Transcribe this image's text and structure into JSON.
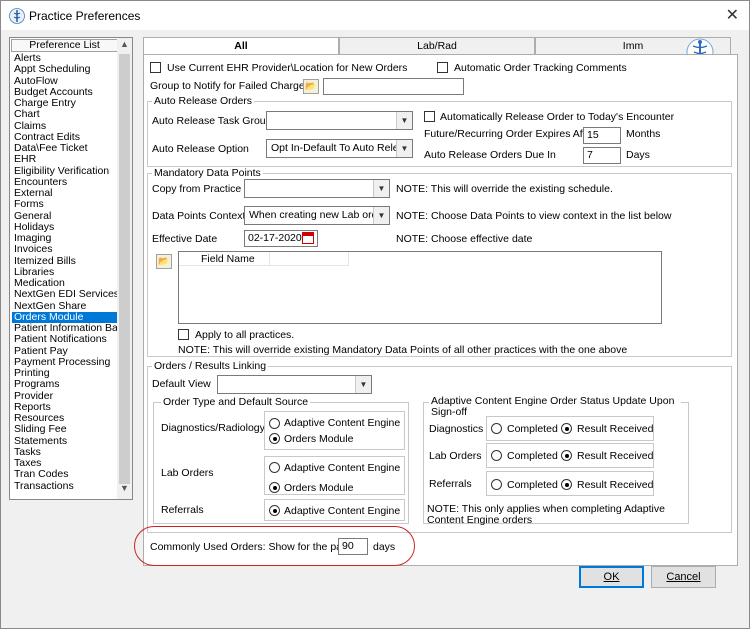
{
  "window": {
    "title": "Practice Preferences",
    "close": "✕"
  },
  "pref_list": {
    "header": "Preference List",
    "items": [
      "Alerts",
      "Appt Scheduling",
      "AutoFlow",
      "Budget Accounts",
      "Charge Entry",
      "Chart",
      "Claims",
      "Contract Edits",
      "Data\\Fee Ticket",
      "EHR",
      "Eligibility Verification",
      "Encounters",
      "External",
      "Forms",
      "General",
      "Holidays",
      "Imaging",
      "Invoices",
      "Itemized Bills",
      "Libraries",
      "Medication",
      "NextGen EDI Services",
      "NextGen Share",
      "Orders Module",
      "Patient Information Bar",
      "Patient Notifications",
      "Patient Pay",
      "Payment Processing",
      "Printing",
      "Programs",
      "Provider",
      "Reports",
      "Resources",
      "Sliding Fee",
      "Statements",
      "Tasks",
      "Taxes",
      "Tran Codes",
      "Transactions"
    ],
    "selected": "Orders Module"
  },
  "tabs": [
    "All",
    "Lab/Rad",
    "Imm"
  ],
  "top": {
    "use_current_label": "Use Current EHR Provider\\Location for New Orders",
    "auto_tracking_label": "Automatic Order Tracking Comments",
    "group_notify_label": "Group to Notify for Failed Charges",
    "group_notify_value": ""
  },
  "auto_release": {
    "title": "Auto Release Orders",
    "task_group_label": "Auto Release Task Group",
    "task_group_value": "",
    "option_label": "Auto Release Option",
    "option_value": "Opt In-Default To Auto Release",
    "auto_release_today_label": "Automatically Release Order to Today's Encounter",
    "expires_label": "Future/Recurring Order Expires After",
    "expires_value": "15",
    "expires_unit": "Months",
    "due_label": "Auto Release Orders Due In",
    "due_value": "7",
    "due_unit": "Days"
  },
  "mandatory": {
    "title": "Mandatory Data Points",
    "copy_label": "Copy from Practice",
    "copy_value": "",
    "copy_note": "NOTE: This will override the existing schedule.",
    "context_label": "Data Points Context",
    "context_value": "When creating new Lab orders",
    "context_note": "NOTE: Choose Data Points to view context in the list below",
    "effective_label": "Effective Date",
    "effective_value": "02-17-2020",
    "effective_note": "NOTE: Choose effective date",
    "field_name_header": "Field Name",
    "apply_all_label": "Apply to all practices.",
    "apply_all_note": "NOTE: This will override existing Mandatory Data Points of all other practices with the one above"
  },
  "orders_results": {
    "title": "Orders / Results Linking",
    "default_view_label": "Default View",
    "default_view_value": "",
    "order_type_title": "Order Type and Default Source",
    "diag_rad_label": "Diagnostics/Radiology",
    "lab_orders_label": "Lab Orders",
    "referrals_label": "Referrals",
    "ace_label": "Adaptive Content Engine",
    "orders_module_label": "Orders Module",
    "ace_status_title": "Adaptive Content Engine Order Status Update Upon Sign-off",
    "diagnostics_label": "Diagnostics",
    "lab_orders_short": "Lab Orders",
    "referrals_short": "Referrals",
    "completed_label": "Completed",
    "result_received_label": "Result Received",
    "ace_note": "NOTE: This only applies when completing Adaptive Content Engine orders"
  },
  "common_orders": {
    "label": "Commonly Used Orders: Show for the past",
    "value": "90",
    "unit": "days"
  },
  "buttons": {
    "ok": "OK",
    "cancel": "Cancel"
  }
}
